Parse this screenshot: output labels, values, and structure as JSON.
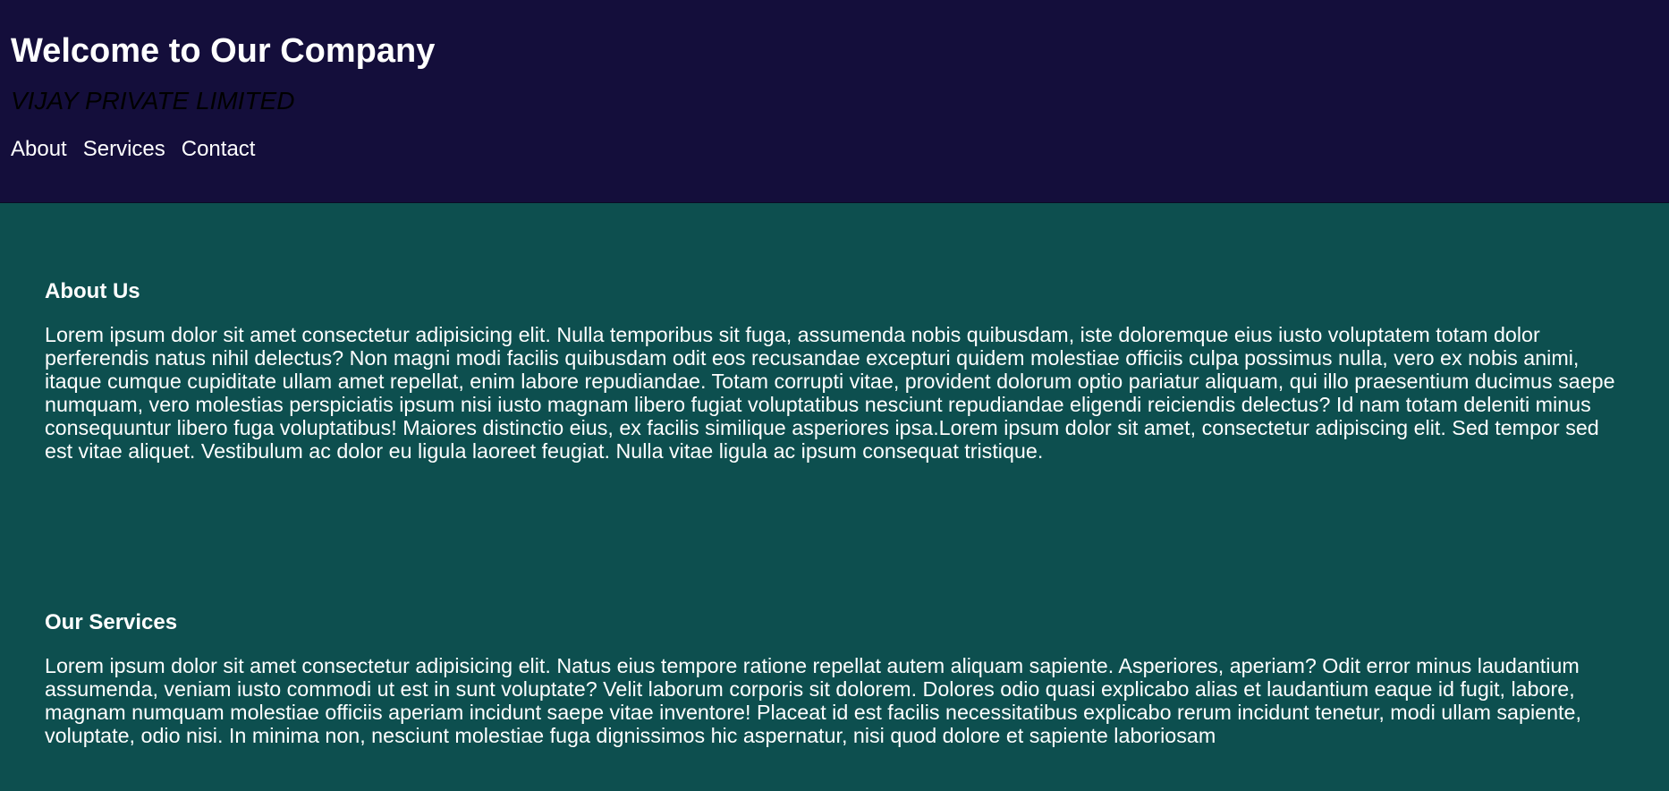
{
  "header": {
    "title": "Welcome to Our Company",
    "company": "VIJAY PRIVATE LIMITED",
    "nav": [
      "About",
      "Services",
      "Contact"
    ]
  },
  "about": {
    "heading": "About Us",
    "body": "Lorem ipsum dolor sit amet consectetur adipisicing elit. Nulla temporibus sit fuga, assumenda nobis quibusdam, iste doloremque eius iusto voluptatem totam dolor perferendis natus nihil delectus? Non magni modi facilis quibusdam odit eos recusandae excepturi quidem molestiae officiis culpa possimus nulla, vero ex nobis animi, itaque cumque cupiditate ullam amet repellat, enim labore repudiandae. Totam corrupti vitae, provident dolorum optio pariatur aliquam, qui illo praesentium ducimus saepe numquam, vero molestias perspiciatis ipsum nisi iusto magnam libero fugiat voluptatibus nesciunt repudiandae eligendi reiciendis delectus? Id nam totam deleniti minus consequuntur libero fuga voluptatibus! Maiores distinctio eius, ex facilis similique asperiores ipsa.Lorem ipsum dolor sit amet, consectetur adipiscing elit. Sed tempor sed est vitae aliquet. Vestibulum ac dolor eu ligula laoreet feugiat. Nulla vitae ligula ac ipsum consequat tristique."
  },
  "services": {
    "heading": "Our Services",
    "body": "Lorem ipsum dolor sit amet consectetur adipisicing elit. Natus eius tempore ratione repellat autem aliquam sapiente. Asperiores, aperiam? Odit error minus laudantium assumenda, veniam iusto commodi ut est in sunt voluptate? Velit laborum corporis sit dolorem. Dolores odio quasi explicabo alias et laudantium eaque id fugit, labore, magnam numquam molestiae officiis aperiam incidunt saepe vitae inventore! Placeat id est facilis necessitatibus explicabo rerum incidunt tenetur, modi ullam sapiente, voluptate, odio nisi. In minima non, nesciunt molestiae fuga dignissimos hic aspernatur, nisi quod dolore et sapiente laboriosam"
  },
  "colors": {
    "header_bg": "#140e3b",
    "main_bg": "#0d4f4f",
    "text": "#ffffff",
    "company_text": "#000000"
  }
}
